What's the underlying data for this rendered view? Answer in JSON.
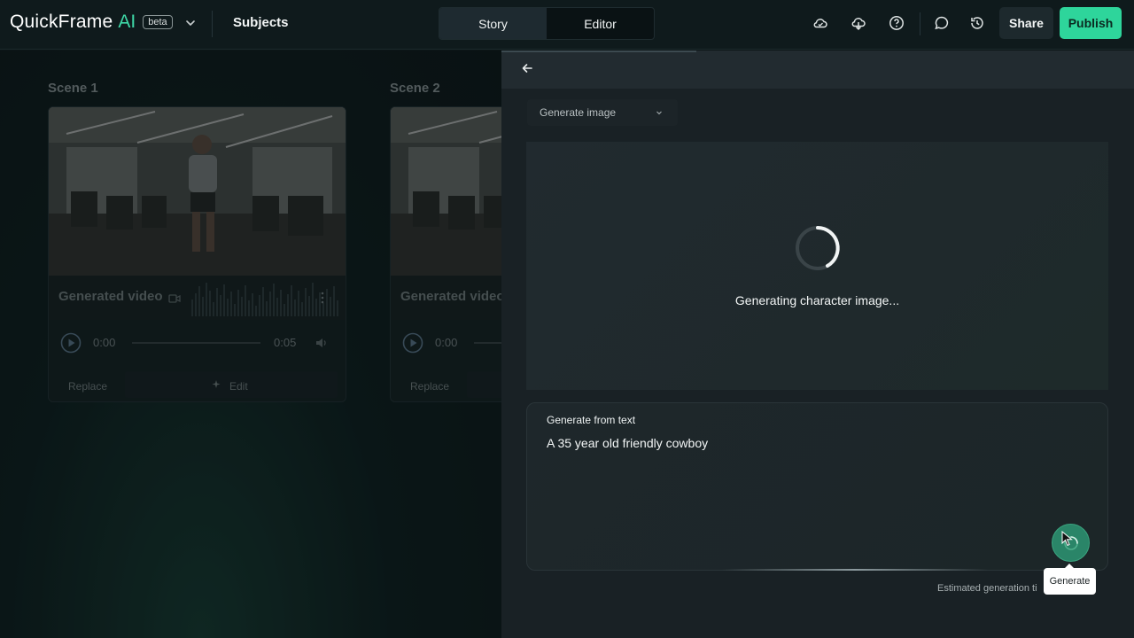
{
  "app": {
    "logo_text": "QuickFrame",
    "logo_ai": "AI",
    "beta_badge": "beta",
    "section_title": "Subjects"
  },
  "tabs": [
    {
      "label": "Story",
      "active": true
    },
    {
      "label": "Editor",
      "active": false
    }
  ],
  "toolbar": {
    "icons": [
      "cloud-icon",
      "download-icon",
      "help-icon",
      "comment-icon",
      "history-icon"
    ],
    "share_label": "Share",
    "publish_label": "Publish"
  },
  "colors": {
    "accent": "#2ed59b",
    "logo_ai": "#3fd9a8",
    "generate_button": "#2a8568"
  },
  "scenes": [
    {
      "label": "Scene 1",
      "video_title": "Generated video",
      "time_current": "0:00",
      "time_total": "0:05",
      "replace_label": "Replace",
      "edit_label": "Edit"
    },
    {
      "label": "Scene 2",
      "video_title": "Generated video",
      "time_current": "0:00",
      "replace_label": "Replace"
    }
  ],
  "panel": {
    "mode_select": "Generate image",
    "status_text": "Generating character image...",
    "prompt_label": "Generate from text",
    "prompt_text": "A 35 year old friendly cowboy",
    "estimated_text": "Estimated generation ti",
    "tooltip": "Generate"
  }
}
